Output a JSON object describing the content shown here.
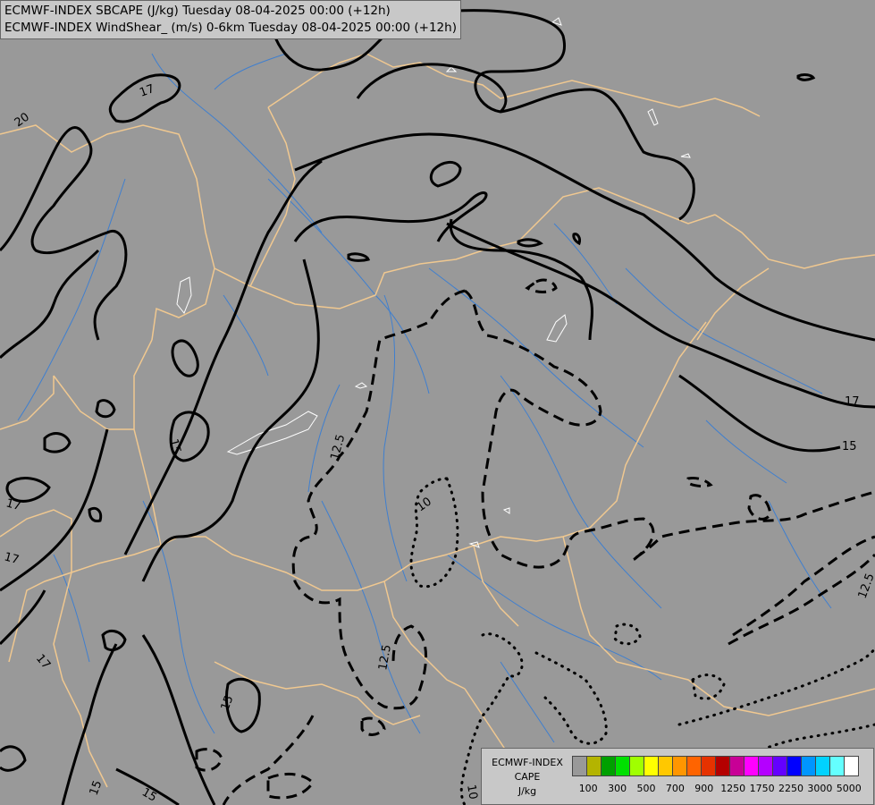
{
  "map": {
    "background_color": "#999999",
    "border_color": "#f0c890",
    "river_color": "#3f7fcf",
    "contour_color": "#000000",
    "cape_contour_color": "#ffffff",
    "windshear_labels": [
      "17",
      "20",
      "15",
      "17",
      "17",
      "17",
      "15",
      "17",
      "15",
      "12.5",
      "10",
      "12.5",
      "12.5",
      "15",
      "15",
      "10"
    ]
  },
  "titles": {
    "line1": "ECMWF-INDEX SBCAPE (J/kg) Tuesday 08-04-2025 00:00 (+12h)",
    "line2": "ECMWF-INDEX WindShear_ (m/s) 0-6km Tuesday 08-04-2025 00:00 (+12h)"
  },
  "legend": {
    "model": "ECMWF-INDEX",
    "field": "CAPE",
    "unit": "J/kg",
    "colors": [
      "#999999",
      "#b4b400",
      "#00a000",
      "#00e000",
      "#a0ff00",
      "#ffff00",
      "#ffc800",
      "#ff9600",
      "#ff6400",
      "#e63200",
      "#b40000",
      "#c80096",
      "#ff00ff",
      "#b400ff",
      "#6400ff",
      "#0000ff",
      "#0096ff",
      "#00d2ff",
      "#64ffff",
      "#ffffff"
    ],
    "ticks": [
      "100",
      "300",
      "500",
      "700",
      "900",
      "1250",
      "1750",
      "2250",
      "3000",
      "5000"
    ]
  }
}
